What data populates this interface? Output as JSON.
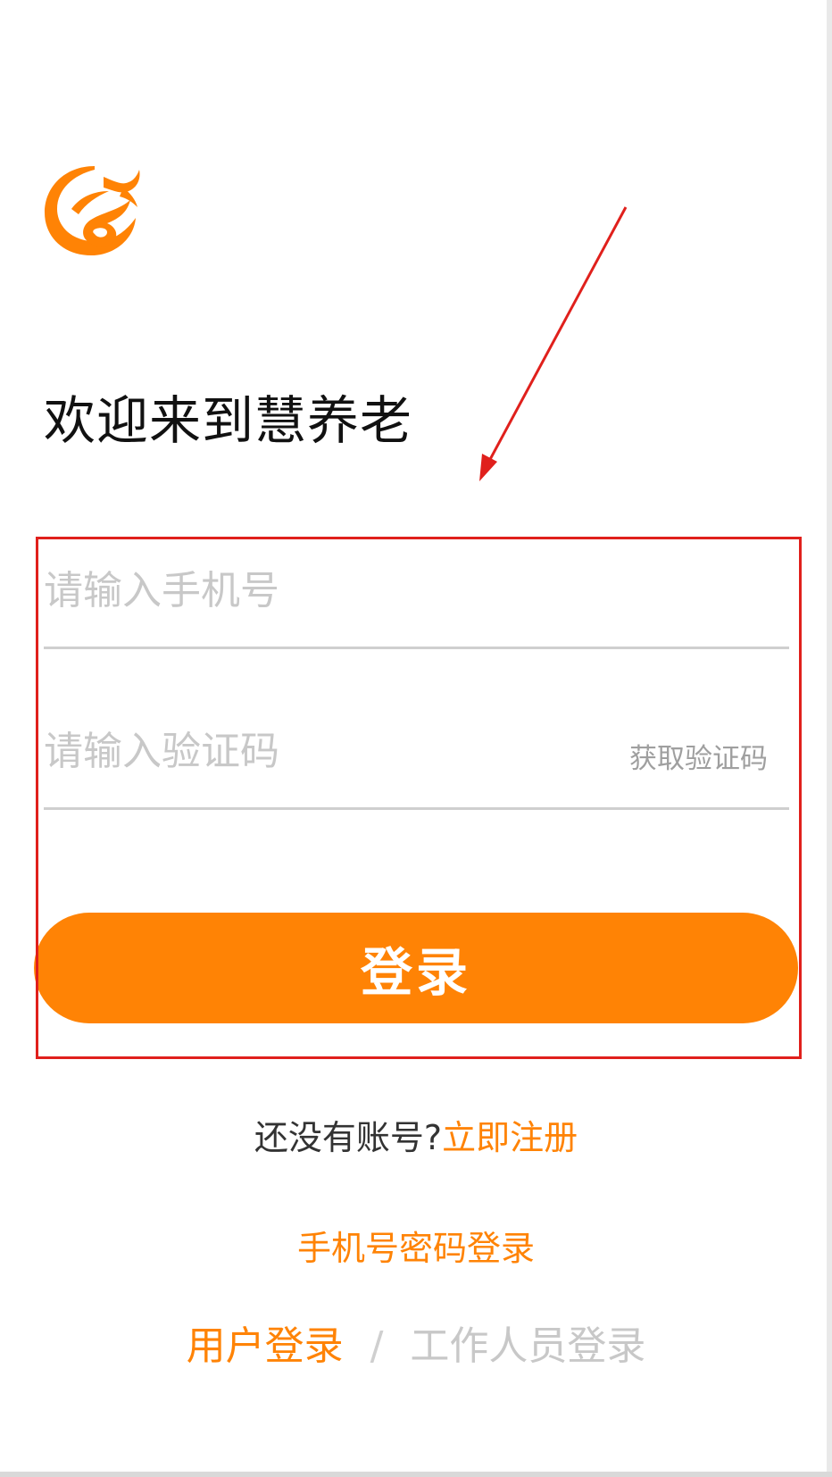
{
  "app": {
    "logo": "huiyanglao-logo",
    "welcome_title": "欢迎来到慧养老"
  },
  "form": {
    "phone_placeholder": "请输入手机号",
    "phone_value": "",
    "code_placeholder": "请输入验证码",
    "code_value": "",
    "get_code_label": "获取验证码",
    "login_label": "登录"
  },
  "links": {
    "register_prompt": "还没有账号?",
    "register_link": "立即注册",
    "password_login": "手机号密码登录"
  },
  "role_switch": {
    "user_login": "用户登录",
    "separator": "/",
    "staff_login": "工作人员登录",
    "active": "user_login"
  },
  "colors": {
    "accent": "#ff8305",
    "annotation": "#e0201c",
    "placeholder": "#c8c8c8",
    "divider": "#cfcfcf"
  }
}
